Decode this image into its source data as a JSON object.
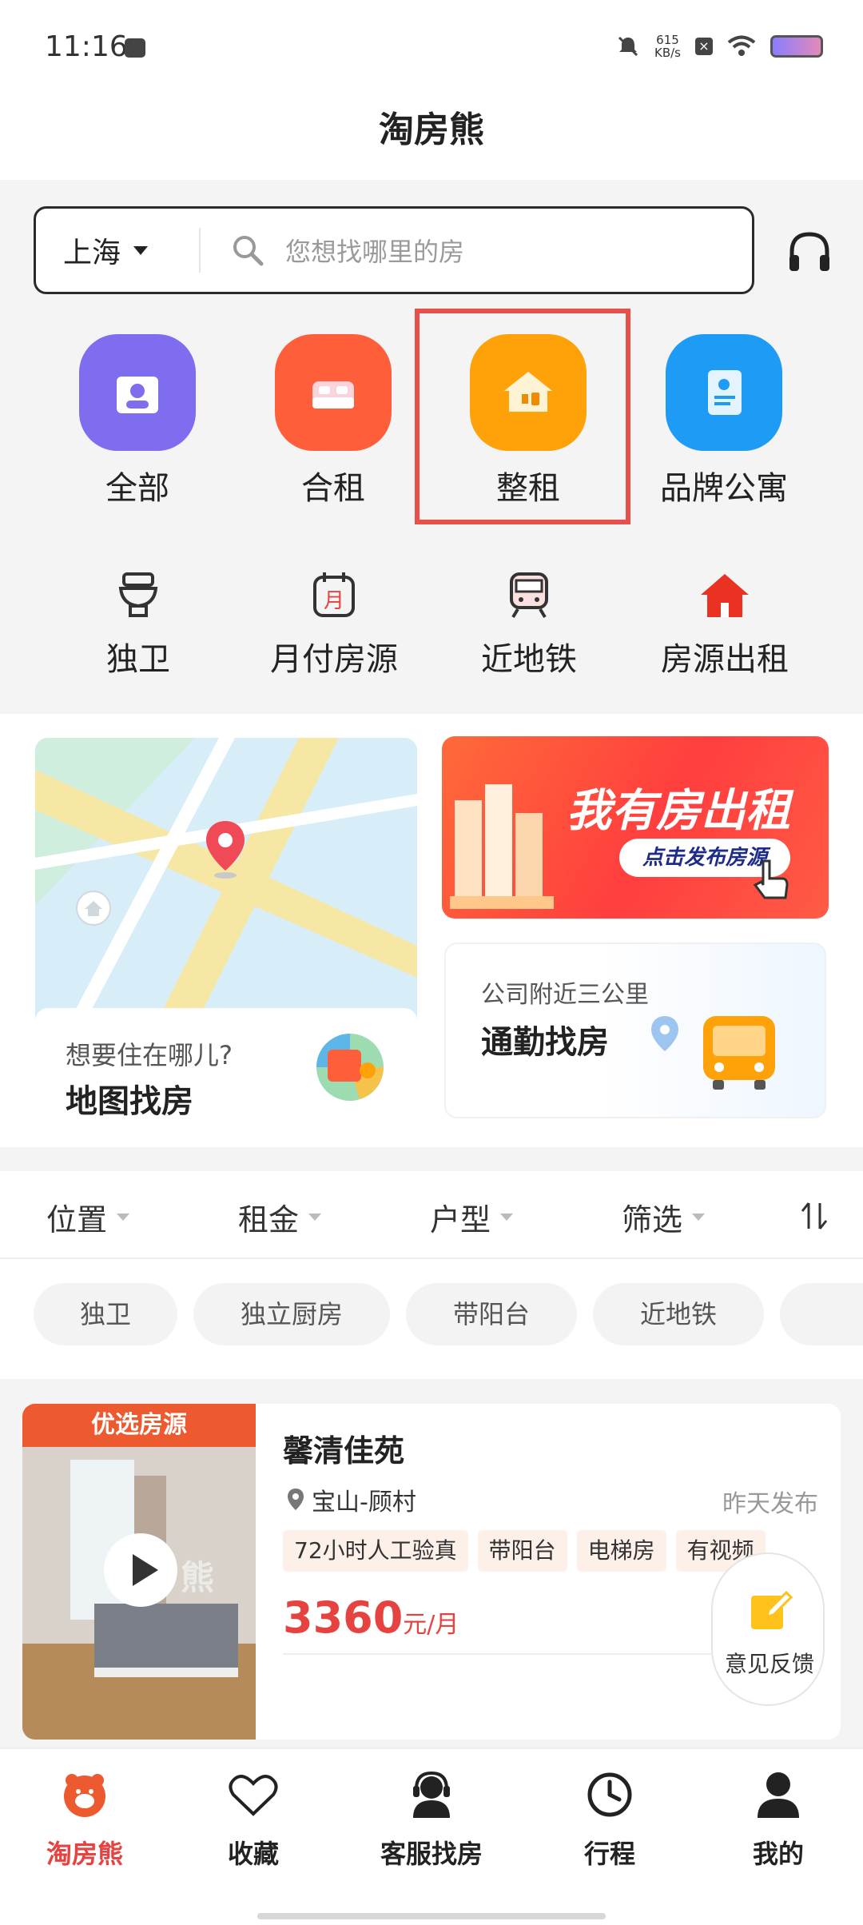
{
  "status": {
    "time": "11:16",
    "speed_value": "615",
    "speed_unit": "KB/s"
  },
  "app_title": "淘房熊",
  "search": {
    "city": "上海",
    "placeholder": "您想找哪里的房"
  },
  "categories": [
    {
      "label": "全部",
      "icon": "all-house-icon",
      "color": "#7f6df0"
    },
    {
      "label": "合租",
      "icon": "bed-icon",
      "color": "#ff5e3a"
    },
    {
      "label": "整租",
      "icon": "house-icon",
      "color": "#ffa20a"
    },
    {
      "label": "品牌公寓",
      "icon": "document-icon",
      "color": "#1e9bf4"
    }
  ],
  "sub_categories": [
    {
      "label": "独卫",
      "icon": "toilet-icon"
    },
    {
      "label": "月付房源",
      "icon": "calendar-icon"
    },
    {
      "label": "近地铁",
      "icon": "subway-icon"
    },
    {
      "label": "房源出租",
      "icon": "red-house-icon"
    }
  ],
  "map_card": {
    "subtitle": "想要住在哪儿?",
    "title": "地图找房"
  },
  "banner": {
    "title": "我有房出租",
    "cta": "点击发布房源"
  },
  "commute_card": {
    "subtitle": "公司附近三公里",
    "title": "通勤找房"
  },
  "filters": [
    "位置",
    "租金",
    "户型",
    "筛选"
  ],
  "tags": [
    "独卫",
    "独立厨房",
    "带阳台",
    "近地铁"
  ],
  "listing": {
    "badge": "优选房源",
    "watermark": "熊",
    "name": "馨清佳苑",
    "location": "宝山-顾村",
    "posted": "昨天发布",
    "tags": [
      "72小时人工验真",
      "带阳台",
      "电梯房",
      "有视频"
    ],
    "price": "3360",
    "price_unit": "元/月"
  },
  "feedback": {
    "label": "意见反馈"
  },
  "tabbar": [
    {
      "label": "淘房熊",
      "icon": "bear-home-icon",
      "active": true
    },
    {
      "label": "收藏",
      "icon": "heart-icon"
    },
    {
      "label": "客服找房",
      "icon": "agent-icon"
    },
    {
      "label": "行程",
      "icon": "clock-icon"
    },
    {
      "label": "我的",
      "icon": "person-icon"
    }
  ],
  "colors": {
    "accent": "#e64340",
    "highlight": "#e8514b",
    "brand_orange": "#ee5a2f"
  }
}
